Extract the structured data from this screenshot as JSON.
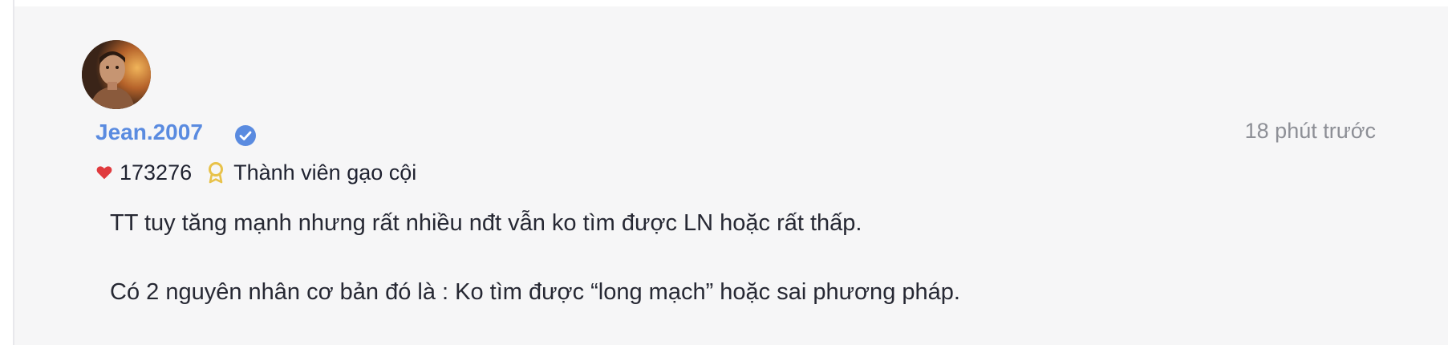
{
  "post": {
    "author": {
      "name": "Jean.2007",
      "verified": true,
      "avatar": "profile-photo"
    },
    "timestamp": "18 phút trước",
    "likes": "173276",
    "rank": "Thành viên gạo cội",
    "paragraphs": [
      "TT tuy tăng mạnh nhưng rất nhiều nđt vẫn ko tìm được LN hoặc rất thấp.",
      "Có 2 nguyên nhân cơ bản đó là : Ko tìm được “long mạch” hoặc sai phương pháp."
    ]
  },
  "icons": {
    "verified": "verified-badge-icon",
    "likes": "heart-icon",
    "rank": "medal-icon"
  },
  "colors": {
    "username": "#5a8be0",
    "verified": "#5a8be0",
    "heart": "#e03a3e",
    "medal": "#e8c24a",
    "timestamp": "#8d8f96",
    "card_background": "#f6f6f7"
  }
}
